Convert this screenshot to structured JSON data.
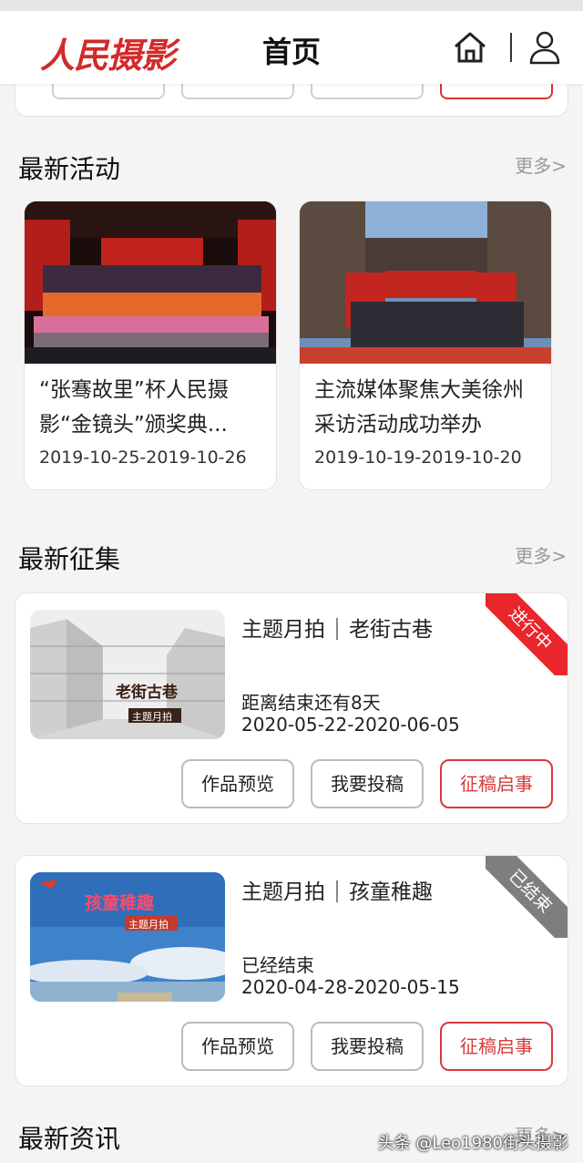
{
  "header": {
    "logo": "人民摄影",
    "title": "首页"
  },
  "sections": {
    "activities_title": "最新活动",
    "collections_title": "最新征集",
    "news_title": "最新资讯",
    "more": "更多>"
  },
  "activities": [
    {
      "title": "“张骞故里”杯人民摄影“金镜头”颁奖典...",
      "date": "2019-10-25-2019-10-26"
    },
    {
      "title": "主流媒体聚焦大美徐州采访活动成功举办",
      "date": "2019-10-19-2019-10-20"
    }
  ],
  "collections": [
    {
      "category": "主题月拍",
      "theme": "老街古巷",
      "image_text": "老街古巷",
      "image_tag": "主题月拍",
      "status": "距离结束还有8天",
      "date": "2020-05-22-2020-06-05",
      "ribbon": "进行中",
      "ribbon_color": "#e8262b"
    },
    {
      "category": "主题月拍",
      "theme": "孩童稚趣",
      "image_text": "孩童稚趣",
      "image_tag": "主题月拍",
      "status": "已经结束",
      "date": "2020-04-28-2020-05-15",
      "ribbon": "已结束",
      "ribbon_color": "#7e7e7e"
    }
  ],
  "buttons": {
    "preview": "作品预览",
    "submit": "我要投稿",
    "notice": "征稿启事"
  },
  "watermark": "头条 @Leo1980街头摄影",
  "colors": {
    "accent": "#d83a3a"
  }
}
